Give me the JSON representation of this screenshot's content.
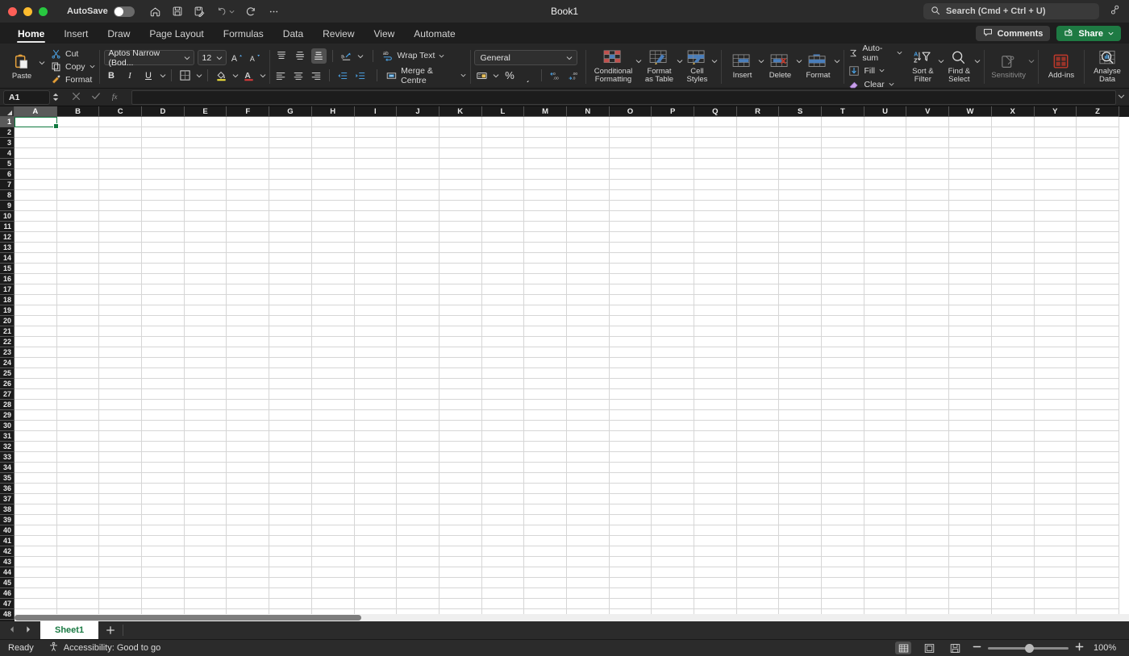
{
  "titlebar": {
    "autosave_label": "AutoSave",
    "window_title": "Book1",
    "quick_access": [
      {
        "name": "home-icon",
        "label": "Home"
      },
      {
        "name": "save-icon",
        "label": "Save"
      },
      {
        "name": "save-as-icon",
        "label": "Save As"
      },
      {
        "name": "undo-icon",
        "label": "Undo"
      },
      {
        "name": "redo-icon",
        "label": "Redo"
      },
      {
        "name": "more-options-icon",
        "label": "More"
      }
    ],
    "search_placeholder": "Search (Cmd + Ctrl + U)",
    "collab_icon": "collaborators-icon"
  },
  "tabs": [
    {
      "label": "Home",
      "active": true
    },
    {
      "label": "Insert",
      "active": false
    },
    {
      "label": "Draw",
      "active": false
    },
    {
      "label": "Page Layout",
      "active": false
    },
    {
      "label": "Formulas",
      "active": false
    },
    {
      "label": "Data",
      "active": false
    },
    {
      "label": "Review",
      "active": false
    },
    {
      "label": "View",
      "active": false
    },
    {
      "label": "Automate",
      "active": false
    }
  ],
  "tabbar": {
    "comments_label": "Comments",
    "share_label": "Share"
  },
  "ribbon": {
    "clipboard": {
      "paste_label": "Paste",
      "cut_label": "Cut",
      "copy_label": "Copy",
      "format_painter_label": "Format"
    },
    "font": {
      "font_name": "Aptos Narrow (Bod...",
      "font_size": "12",
      "grow_font": "A",
      "shrink_font": "A",
      "bold": "B",
      "italic": "I",
      "underline": "U"
    },
    "alignment": {
      "wrap_text_label": "Wrap Text",
      "merge_label": "Merge & Centre"
    },
    "number": {
      "format_value": "General",
      "percent": "%",
      "comma": "͵"
    },
    "styles": {
      "conditional_formatting_line1": "Conditional",
      "conditional_formatting_line2": "Formatting",
      "format_as_table_line1": "Format",
      "format_as_table_line2": "as Table",
      "cell_styles_line1": "Cell",
      "cell_styles_line2": "Styles"
    },
    "cells": {
      "insert_label": "Insert",
      "delete_label": "Delete",
      "format_label": "Format"
    },
    "editing": {
      "autosum_label": "Auto-sum",
      "fill_label": "Fill",
      "clear_label": "Clear",
      "sort_filter_line1": "Sort &",
      "sort_filter_line2": "Filter",
      "find_select_line1": "Find &",
      "find_select_line2": "Select"
    },
    "extras": {
      "sensitivity_label": "Sensitivity",
      "addins_label": "Add-ins",
      "analyse_line1": "Analyse",
      "analyse_line2": "Data"
    }
  },
  "formula_bar": {
    "name_box": "A1",
    "formula_value": "",
    "cancel_icon": "cancel-icon",
    "enter_icon": "confirm-icon",
    "function_icon": "insert-function-icon"
  },
  "grid": {
    "columns": [
      "A",
      "B",
      "C",
      "D",
      "E",
      "F",
      "G",
      "H",
      "I",
      "J",
      "K",
      "L",
      "M",
      "N",
      "O",
      "P",
      "Q",
      "R",
      "S",
      "T",
      "U",
      "V",
      "W",
      "X",
      "Y",
      "Z"
    ],
    "rows": [
      1,
      2,
      3,
      4,
      5,
      6,
      7,
      8,
      9,
      10,
      11,
      12,
      13,
      14,
      15,
      16,
      17,
      18,
      19,
      20,
      21,
      22,
      23,
      24,
      25,
      26,
      27,
      28,
      29,
      30,
      31,
      32,
      33,
      34,
      35,
      36,
      37,
      38,
      39,
      40,
      41,
      42,
      43,
      44,
      45,
      46,
      47,
      48
    ],
    "selected_cell": "A1",
    "selected_column": "A",
    "selected_row": 1
  },
  "sheet_tabs": {
    "sheets": [
      {
        "label": "Sheet1",
        "active": true
      }
    ],
    "add_sheet_label": "+"
  },
  "statusbar": {
    "mode": "Ready",
    "accessibility": "Accessibility: Good to go",
    "zoom_level": "100%",
    "views": [
      {
        "name": "normal-view-button",
        "active": true
      },
      {
        "name": "page-layout-view-button",
        "active": false
      },
      {
        "name": "page-break-view-button",
        "active": false
      }
    ]
  },
  "colors": {
    "accent_green": "#1e7a43",
    "selection_green": "#10793f",
    "ribbon_bg": "#272727",
    "titlebar_bg": "#2b2b2b"
  }
}
